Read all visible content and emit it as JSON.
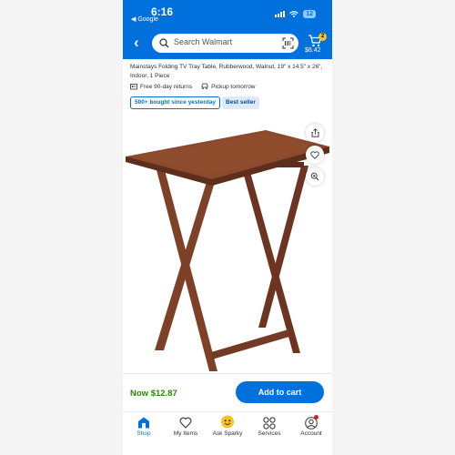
{
  "status_bar": {
    "time": "6:16",
    "back_app": "◀ Google",
    "battery": "12"
  },
  "header": {
    "back_icon": "chevron-left-icon",
    "search_placeholder": "Search Walmart",
    "cart": {
      "count": "2",
      "total": "$6.42"
    }
  },
  "product": {
    "title": "Mainstays Folding TV Tray Table, Rubberwood, Walnut, 19\" x 14.5\" x 26\", Indoor, 1 Piece",
    "returns": "Free 90-day returns",
    "pickup": "Pickup tomorrow",
    "badges": {
      "bought": "500+ bought since yesterday",
      "best": "Best seller"
    },
    "image_actions": [
      "share-icon",
      "heart-icon",
      "zoom-icon"
    ]
  },
  "footer": {
    "price": "Now $12.87",
    "add_to_cart": "Add to cart"
  },
  "tabs": [
    {
      "label": "Shop",
      "icon": "shop-icon",
      "active": true
    },
    {
      "label": "My Items",
      "icon": "heart-icon"
    },
    {
      "label": "Ask Sparky",
      "icon": "sparky-icon"
    },
    {
      "label": "Services",
      "icon": "services-icon"
    },
    {
      "label": "Account",
      "icon": "account-icon"
    }
  ],
  "colors": {
    "brand_blue": "#0071dc",
    "price_green": "#2a8703",
    "spark_yellow": "#ffc220",
    "wood": "#7a3e26"
  }
}
